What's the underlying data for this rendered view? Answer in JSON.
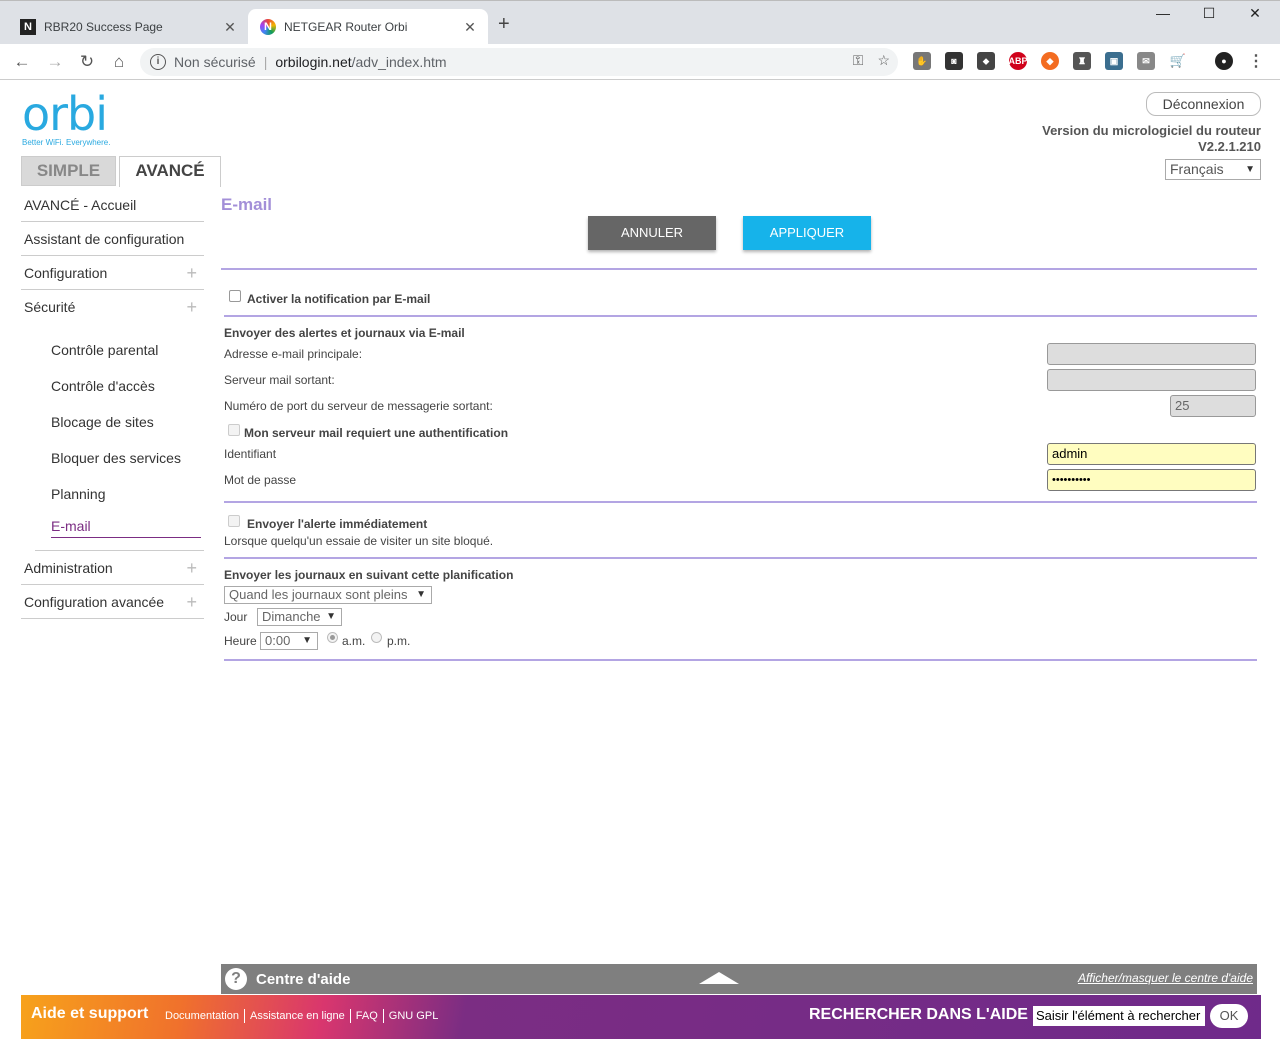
{
  "browser": {
    "tabs": [
      {
        "title": "RBR20 Success Page",
        "favicon": "N"
      },
      {
        "title": "NETGEAR Router Orbi",
        "favicon": "N"
      }
    ],
    "new_tab": "+",
    "address": {
      "security": "Non sécurisé",
      "host": "orbilogin.net",
      "path": "/adv_index.htm"
    }
  },
  "header": {
    "logo": "orbi",
    "tagline": "Better WiFi. Everywhere.",
    "logout": "Déconnexion",
    "firmware_label": "Version du micrologiciel du routeur",
    "firmware_version": "V2.2.1.210",
    "language": "Français"
  },
  "modes": {
    "simple": "SIMPLE",
    "advanced": "AVANCÉ"
  },
  "sidebar": {
    "items": [
      {
        "label": "AVANCÉ - Accueil"
      },
      {
        "label": "Assistant de configuration"
      },
      {
        "label": "Configuration"
      },
      {
        "label": "Sécurité"
      }
    ],
    "security_sub": [
      {
        "label": "Contrôle parental"
      },
      {
        "label": "Contrôle d'accès"
      },
      {
        "label": "Blocage de sites"
      },
      {
        "label": "Bloquer des services"
      },
      {
        "label": "Planning"
      },
      {
        "label": "E-mail"
      }
    ],
    "bottom_items": [
      {
        "label": "Administration"
      },
      {
        "label": "Configuration avancée"
      }
    ]
  },
  "main": {
    "title": "E-mail",
    "cancel": "ANNULER",
    "apply": "APPLIQUER",
    "enable_notification": "Activer la notification par E-mail",
    "section_alerts": "Envoyer des alertes et journaux via E-mail",
    "primary_email_label": "Adresse e-mail principale:",
    "primary_email_value": "",
    "smtp_label": "Serveur mail sortant:",
    "smtp_value": "",
    "port_label": "Numéro de port du serveur de messagerie sortant:",
    "port_value": "25",
    "auth_required": "Mon serveur mail requiert une authentification",
    "username_label": "Identifiant",
    "username_value": "admin",
    "password_label": "Mot de passe",
    "password_value": "••••••••••",
    "send_alert_now": "Envoyer l'alerte immédiatement",
    "send_alert_desc": "Lorsque quelqu'un essaie de visiter un site bloqué.",
    "section_schedule": "Envoyer les journaux en suivant cette planification",
    "schedule_value": "Quand les journaux sont pleins",
    "day_label": "Jour",
    "day_value": "Dimanche",
    "hour_label": "Heure",
    "hour_value": "0:00",
    "am": "a.m.",
    "pm": "p.m."
  },
  "help": {
    "title": "Centre d'aide",
    "toggle": "Afficher/masquer le centre d'aide"
  },
  "footer": {
    "support": "Aide et support",
    "links": [
      "Documentation",
      "Assistance en ligne",
      "FAQ",
      "GNU GPL"
    ],
    "search_title": "RECHERCHER DANS L'AIDE",
    "search_value": "Saisir l'élément à rechercher",
    "ok": "OK"
  }
}
